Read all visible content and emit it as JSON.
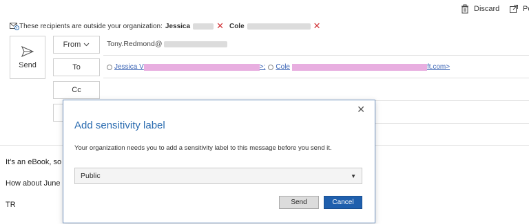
{
  "toolbar": {
    "discard_label": "Discard",
    "popout_label": "Po"
  },
  "outside_notice": {
    "text": "These recipients are outside your organization:",
    "recipient1": "Jessica",
    "recipient2": "Cole"
  },
  "compose": {
    "send_label": "Send",
    "from_label": "From",
    "from_value": "Tony.Redmond@",
    "to_label": "To",
    "to_recipient1_visible": "Jessica V",
    "to_recipient1_tail": ">;",
    "to_recipient2_visible": "Cole",
    "to_recipient2_tail": "ft.com>",
    "cc_label": "Cc"
  },
  "body": {
    "line1": "It’s an eBook, so",
    "line2": "How about June",
    "line3": "TR"
  },
  "dialog": {
    "title": "Add sensitivity label",
    "message": "Your organization needs you to add a sensitivity label to this message before you send it.",
    "selected_label": "Public",
    "send_button": "Send",
    "cancel_button": "Cancel",
    "close_symbol": "✕"
  },
  "colors": {
    "accent": "#2b6cb0",
    "primary_button": "#1f5fad",
    "recipient_error": "#d13438",
    "link": "#3b64b5"
  }
}
